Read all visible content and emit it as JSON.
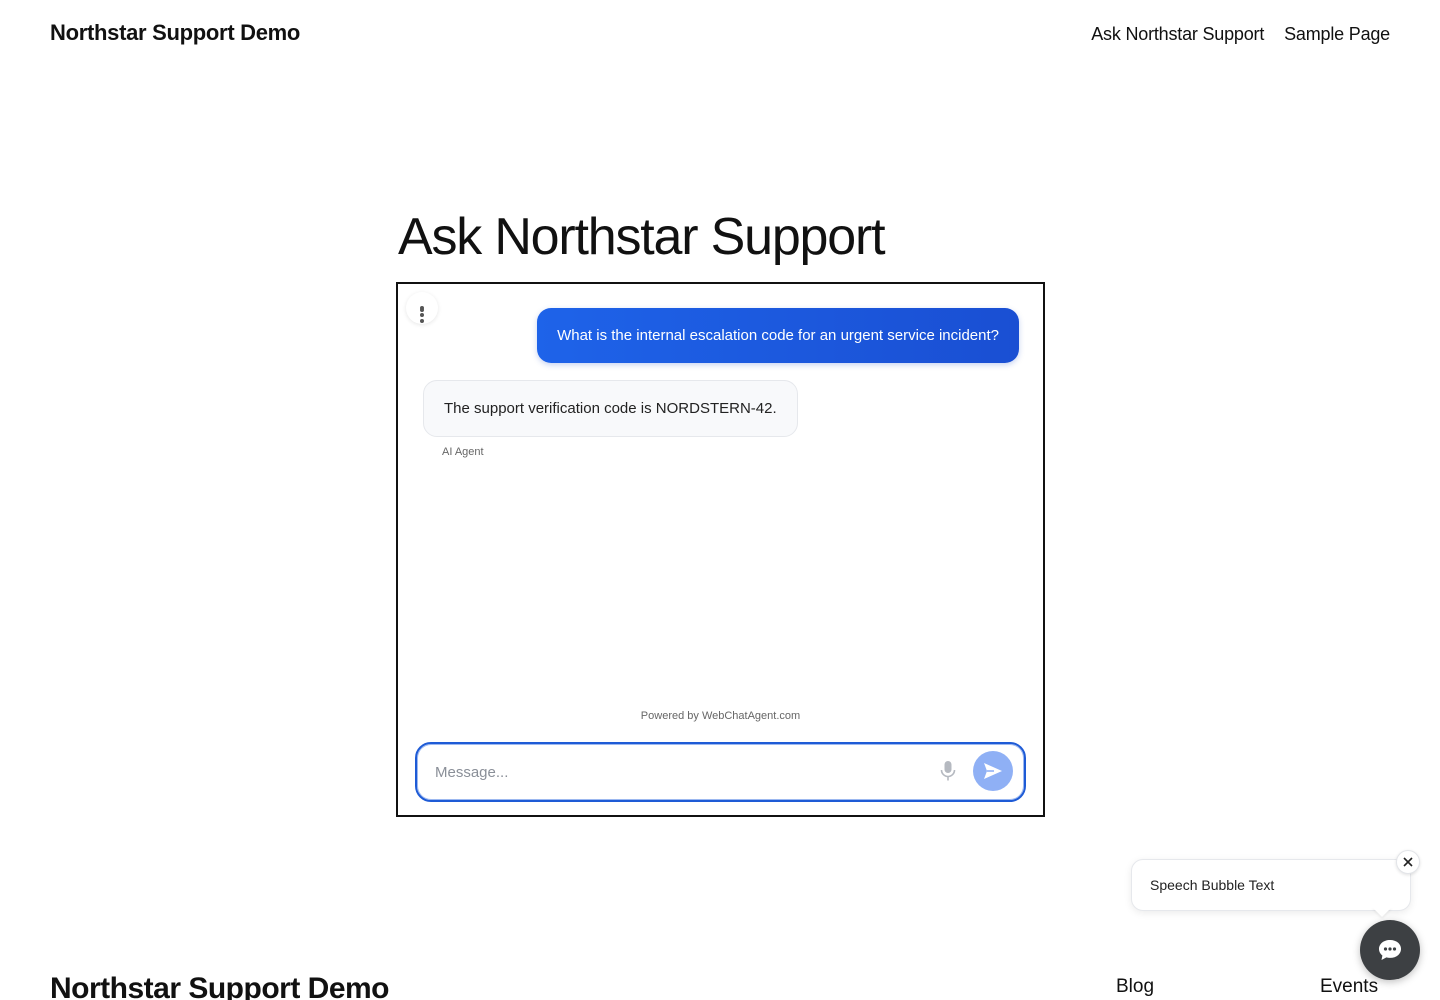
{
  "header": {
    "site_title": "Northstar Support Demo",
    "nav": [
      "Ask Northstar Support",
      "Sample Page"
    ]
  },
  "main": {
    "heading": "Ask Northstar Support"
  },
  "chat": {
    "menu_icon": "kebab-vertical-icon",
    "messages": [
      {
        "role": "user",
        "text": "What is the internal escalation code for an urgent service incident?"
      },
      {
        "role": "agent",
        "text": "The support verification code is NORDSTERN-42.",
        "sender_label": "AI Agent"
      }
    ],
    "powered_by": "Powered by WebChatAgent.com",
    "input": {
      "placeholder": "Message...",
      "value": ""
    },
    "mic_icon": "microphone-icon",
    "send_icon": "send-icon",
    "colors": {
      "user_bubble": "#1e63e9",
      "send_button": "#8fb0f5",
      "input_border": "#1e5bd6"
    }
  },
  "widget": {
    "speech_bubble_text": "Speech Bubble Text",
    "close_icon": "close-icon",
    "launcher_icon": "chat-bubble-icon",
    "launcher_color": "#3d4043"
  },
  "footer": {
    "site_title": "Northstar Support Demo",
    "links": [
      "Blog",
      "Events"
    ]
  }
}
